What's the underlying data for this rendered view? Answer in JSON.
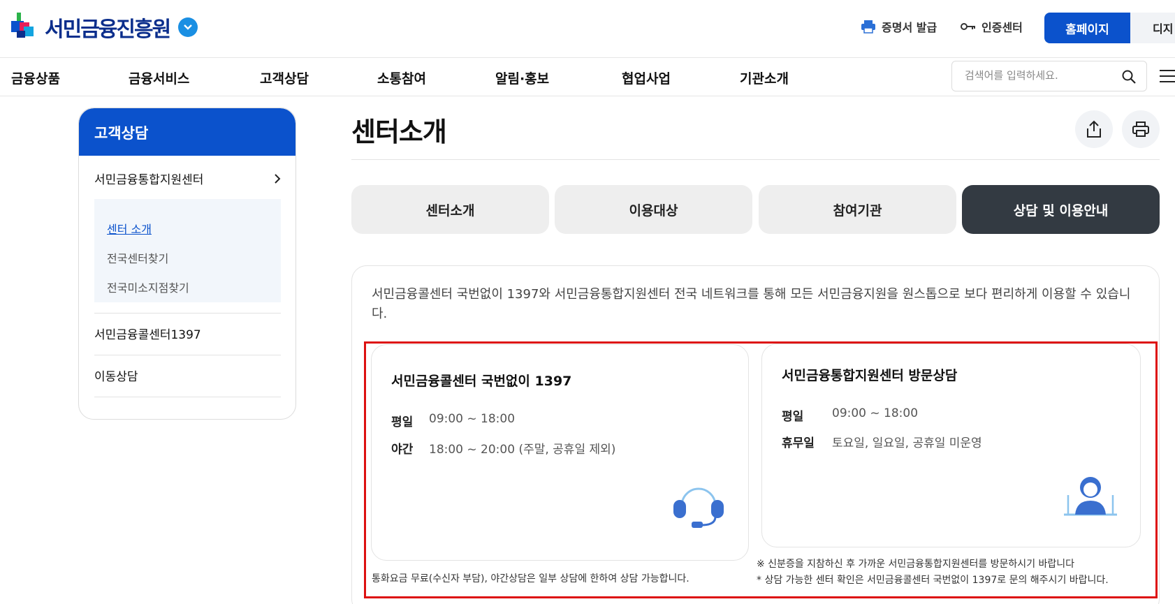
{
  "header": {
    "logo_text": "서민금융진흥원",
    "util_cert": "증명서 발급",
    "util_auth": "인증센터",
    "btn_home": "홈페이지",
    "btn_digital": "디지"
  },
  "gnb": {
    "items": [
      "금융상품",
      "금융서비스",
      "고객상담",
      "소통참여",
      "알림·홍보",
      "협업사업",
      "기관소개"
    ],
    "search_placeholder": "검색어를 입력하세요."
  },
  "sidebar": {
    "title": "고객상담",
    "group1": "서민금융통합지원센터",
    "sub": [
      "센터 소개",
      "전국센터찾기",
      "전국미소지점찾기"
    ],
    "group2": "서민금융콜센터1397",
    "group3": "이동상담"
  },
  "main": {
    "title": "센터소개",
    "tabs": [
      "센터소개",
      "이용대상",
      "참여기관",
      "상담 및 이용안내"
    ],
    "active_tab": 3,
    "intro": "서민금융콜센터 국번없이 1397와 서민금융통합지원센터 전국 네트워크를 통해 모든 서민금융지원을 원스톱으로 보다 편리하게 이용할 수 있습니다.",
    "card1": {
      "title": "서민금융콜센터 국번없이 1397",
      "row1_label": "평일",
      "row1_val": "09:00 ~ 18:00",
      "row2_label": "야간",
      "row2_val": "18:00 ~ 20:00 (주말, 공휴일 제외)",
      "note": "통화요금 무료(수신자 부담), 야간상담은 일부 상담에 한하여 상담 가능합니다."
    },
    "card2": {
      "title": "서민금융통합지원센터 방문상담",
      "row1_label": "평일",
      "row1_val": "09:00 ~ 18:00",
      "row2_label": "휴무일",
      "row2_val": "토요일, 일요일, 공휴일 미운영",
      "note1": "※ 신분증을 지참하신 후 가까운 서민금융통합지원센터를 방문하시기 바랍니다",
      "note2": "* 상담 가능한 센터 확인은 서민금융콜센터 국번없이 1397로 문의 해주시기 바랍니다."
    }
  },
  "colors": {
    "brand": "#0b52cc",
    "active_tab": "#333a42",
    "highlight": "#dd1111"
  }
}
